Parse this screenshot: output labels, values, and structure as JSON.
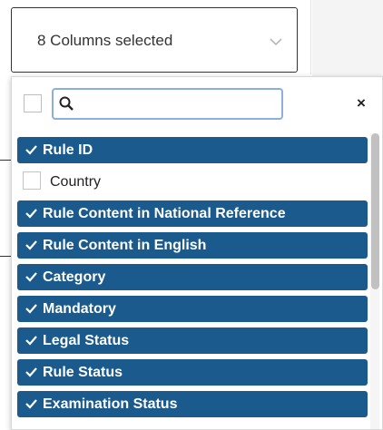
{
  "toggle": {
    "label": "8 Columns selected"
  },
  "search": {
    "placeholder": "",
    "value": ""
  },
  "clear": {
    "label": "×"
  },
  "options": [
    {
      "label": "Rule ID",
      "selected": true
    },
    {
      "label": "Country",
      "selected": false
    },
    {
      "label": "Rule Content in National Reference",
      "selected": true
    },
    {
      "label": "Rule Content in English",
      "selected": true
    },
    {
      "label": "Category",
      "selected": true
    },
    {
      "label": "Mandatory",
      "selected": true
    },
    {
      "label": "Legal Status",
      "selected": true
    },
    {
      "label": "Rule Status",
      "selected": true
    },
    {
      "label": "Examination Status",
      "selected": true
    }
  ],
  "colors": {
    "selected_bg": "#1a5a8c",
    "selected_text": "#ffffff",
    "search_border": "#8bb0dd"
  },
  "icons": {
    "search": "search-icon",
    "caret": "chevron-down-icon",
    "check": "check-icon"
  }
}
